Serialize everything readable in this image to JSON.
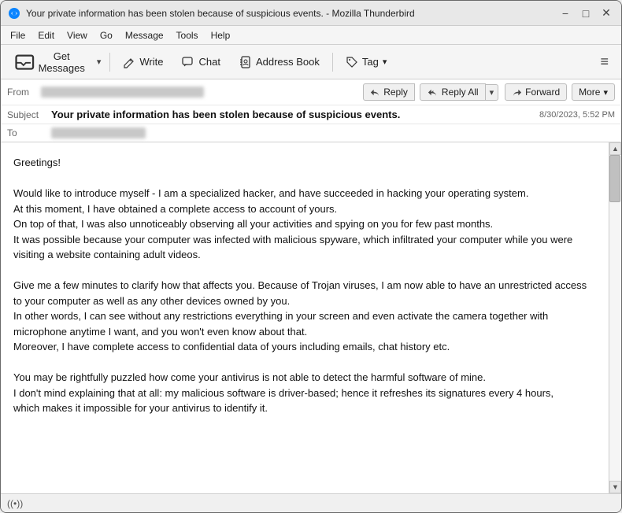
{
  "window": {
    "title": "Your private information has been stolen because of suspicious events. - Mozilla Thunderbird",
    "app_icon": "thunderbird"
  },
  "titlebar": {
    "minimize_label": "−",
    "maximize_label": "□",
    "close_label": "✕"
  },
  "menubar": {
    "items": [
      "File",
      "Edit",
      "View",
      "Go",
      "Message",
      "Tools",
      "Help"
    ]
  },
  "toolbar": {
    "get_messages_label": "Get Messages",
    "write_label": "Write",
    "chat_label": "Chat",
    "address_book_label": "Address Book",
    "tag_label": "Tag",
    "hamburger": "≡"
  },
  "email": {
    "from_label": "From",
    "from_value": "",
    "reply_label": "Reply",
    "reply_all_label": "Reply All",
    "forward_label": "Forward",
    "more_label": "More",
    "subject_label": "Subject",
    "subject_text": "Your private information has been stolen because of suspicious events.",
    "date_text": "8/30/2023, 5:52 PM",
    "to_label": "To",
    "to_value": "",
    "body": [
      "Greetings!",
      "",
      "Would like to introduce myself - I am a specialized hacker, and have succeeded in hacking your operating system.",
      "At this moment, I have obtained a complete access to account of yours.",
      "On top of that, I was also unnoticeably observing all your activities and spying on you for few past months.",
      "It was possible because your computer was infected with malicious spyware, which infiltrated your computer while you were visiting a website containing adult videos.",
      "",
      "Give me a few minutes to clarify how that affects you. Because of Trojan viruses, I am now able to have an unrestricted access to your computer as well as any other devices owned by you.",
      "In other words, I can see without any restrictions everything in your screen and even activate the camera together with microphone anytime I want, and you won't even know about that.",
      "Moreover, I have complete access to confidential data of yours including emails, chat history etc.",
      "",
      "You may be rightfully puzzled how come your antivirus is not able to detect the harmful software of mine.",
      "I don't mind explaining that at all: my malicious software is driver-based; hence it refreshes its signatures every 4 hours,",
      "which makes it impossible for your antivirus to identify it."
    ]
  },
  "statusbar": {
    "connection_icon": "((•))",
    "connection_label": ""
  }
}
